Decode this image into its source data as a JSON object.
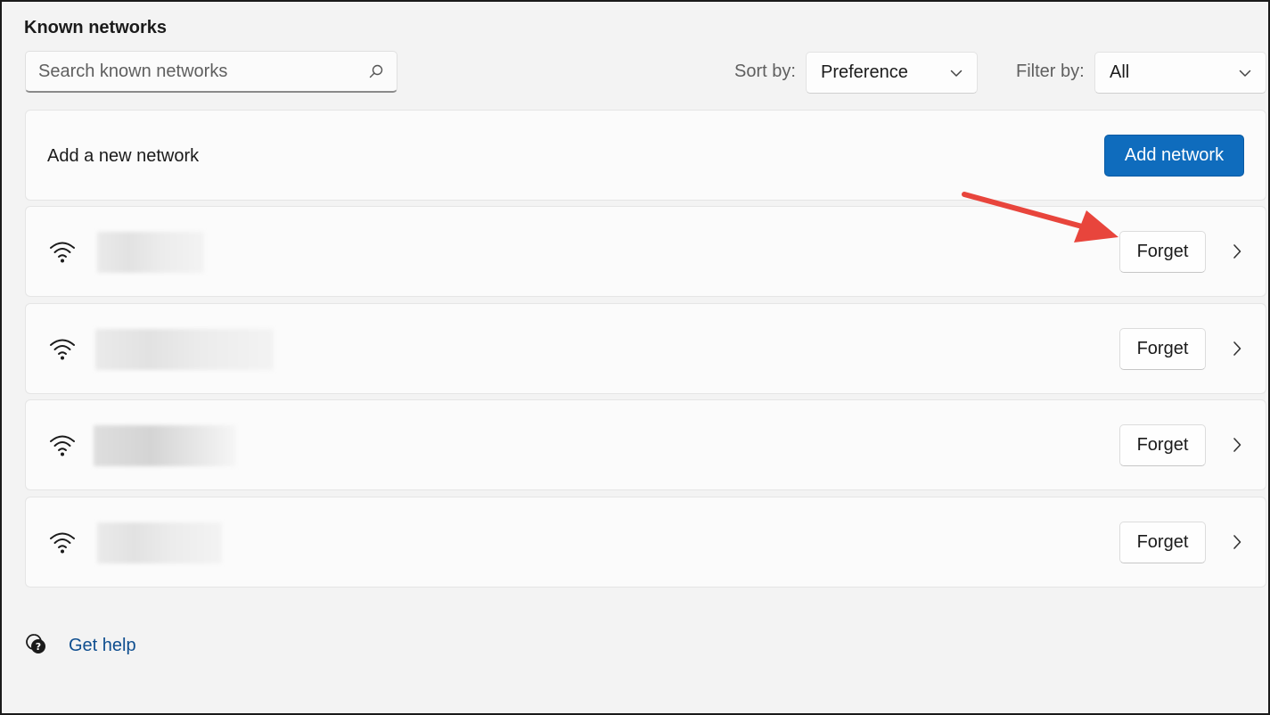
{
  "section": {
    "title": "Known networks"
  },
  "search": {
    "placeholder": "Search known networks",
    "value": "",
    "icon": "search-icon"
  },
  "sort": {
    "label": "Sort by:",
    "selected": "Preference"
  },
  "filter": {
    "label": "Filter by:",
    "selected": "All"
  },
  "add_network": {
    "text": "Add a new network",
    "button_label": "Add network",
    "button_color": "#0f6cbd"
  },
  "networks": [
    {
      "forget_label": "Forget",
      "icon": "wifi-icon"
    },
    {
      "forget_label": "Forget",
      "icon": "wifi-icon"
    },
    {
      "forget_label": "Forget",
      "icon": "wifi-icon"
    },
    {
      "forget_label": "Forget",
      "icon": "wifi-icon"
    }
  ],
  "help": {
    "label": "Get help",
    "icon": "help-icon"
  },
  "annotation": {
    "arrow_color": "#e8453c"
  }
}
